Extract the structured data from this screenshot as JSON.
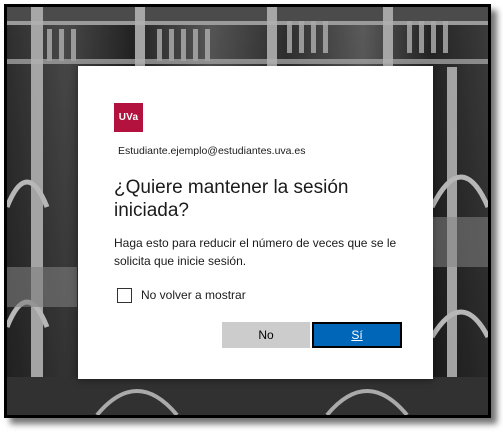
{
  "dialog": {
    "logo_text": "UVa",
    "email": "Estudiante.ejemplo@estudiantes.uva.es",
    "title": "¿Quiere mantener la sesión iniciada?",
    "description": "Haga esto para reducir el número de veces que se le solicita que inicie sesión.",
    "checkbox_label": "No volver a mostrar",
    "checkbox_checked": false,
    "no_button": "No",
    "yes_button": "Sí"
  },
  "colors": {
    "brand": "#b3123f",
    "primary_button": "#0067b8",
    "secondary_button": "#cccccc"
  }
}
